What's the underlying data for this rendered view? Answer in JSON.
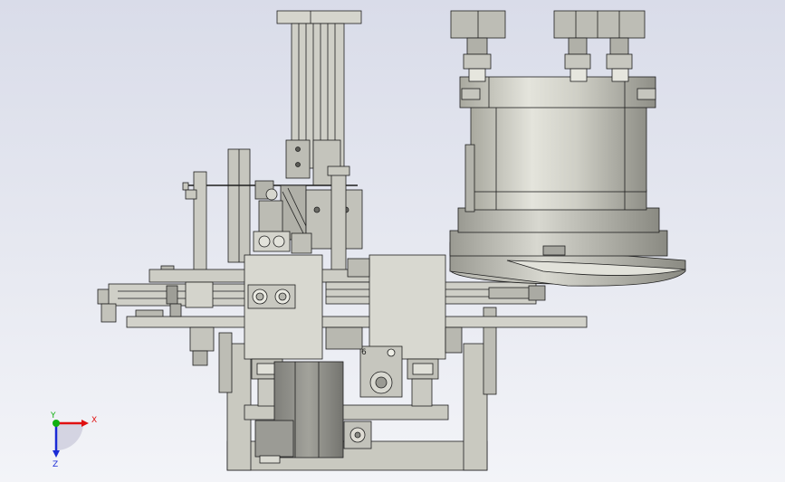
{
  "colors": {
    "background_top": "#d9dce9",
    "background_bottom": "#f3f4f8",
    "part_fill": "#c9c9c0",
    "part_light": "#dcdcd4",
    "part_dark": "#a9a9a2",
    "edge": "#1e1e1e",
    "axis_x": "#e01010",
    "axis_y": "#10b010",
    "axis_z": "#1a2bd6"
  },
  "triad": {
    "x_label": "X",
    "y_label": "Y",
    "z_label": "Z"
  },
  "part_labels": {
    "small_mark": "6"
  }
}
